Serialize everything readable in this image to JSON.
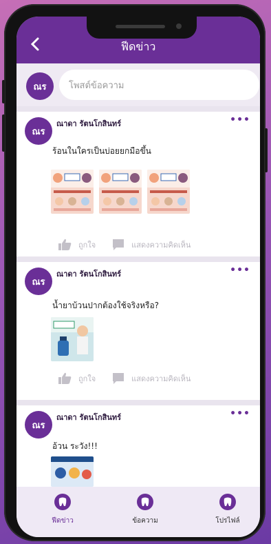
{
  "app": {
    "title": "ฟีดข่าว"
  },
  "composer": {
    "avatar_text": "ณร",
    "placeholder": "โพสต์ข้อความ"
  },
  "posts": [
    {
      "author": "ณาดา รัตนโกสินทร์",
      "text": "ร้อนในใครเป็นบ่อยยกมือขึ้น",
      "avatar_text": "ณร",
      "like_label": "ถูกใจ",
      "comment_label": "แสดงความคิดเห็น"
    },
    {
      "author": "ณาดา รัตนโกสินทร์",
      "text": "น้ำยาบ้วนปากต้องใช้จริงหรือ?",
      "avatar_text": "ณร",
      "like_label": "ถูกใจ",
      "comment_label": "แสดงความคิดเห็น"
    },
    {
      "author": "ณาดา รัตนโกสินทร์",
      "text": "อ้วน ระวัง!!!",
      "avatar_text": "ณร"
    }
  ],
  "bottom_nav": {
    "items": [
      {
        "label": "ฟีดข่าว",
        "icon": "tooth-icon",
        "active": true
      },
      {
        "label": "ข้อความ",
        "icon": "tooth-icon",
        "active": false
      },
      {
        "label": "โปรไฟล์",
        "icon": "tooth-icon",
        "active": false
      }
    ]
  },
  "colors": {
    "primary": "#6a2f97",
    "background": "#e9e4ee"
  }
}
